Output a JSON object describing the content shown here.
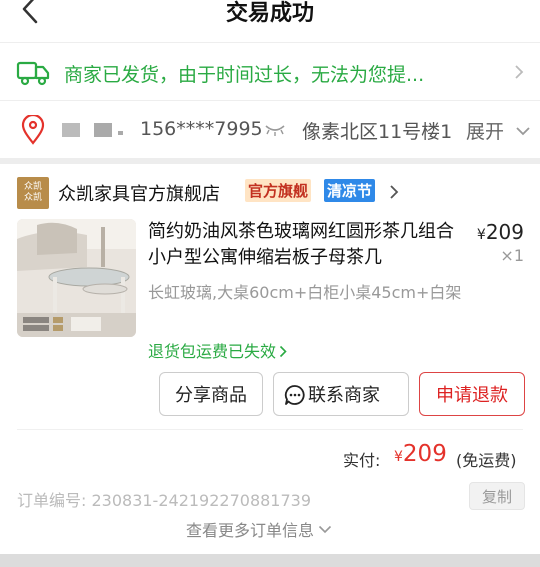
{
  "header": {
    "title": "交易成功"
  },
  "shipping": {
    "text": "商家已发货，由于时间过长，无法为您提..."
  },
  "address": {
    "phone": "156****7995",
    "text": "像素北区11号楼1",
    "expand_label": "展开"
  },
  "shop": {
    "logo_lines": [
      "众凯",
      "众凯"
    ],
    "name": "众凯家具官方旗舰店",
    "badge_official": "官方旗舰",
    "badge_promo": "清凉节"
  },
  "product": {
    "title": "简约奶油风茶色玻璃网红圆形茶几组合小户型公寓伸缩岩板子母茶几",
    "price_symbol": "¥",
    "price": "209",
    "qty": "×1",
    "spec": "长虹玻璃,大桌60cm+白柜小桌45cm+白架",
    "refund_note": "退货包运费已失效"
  },
  "actions": {
    "share_label": "分享商品",
    "contact_label": "联系商家",
    "refund_label": "申请退款"
  },
  "payment": {
    "label": "实付:",
    "symbol": "¥",
    "amount": "209",
    "shipping_note": "(免运费)"
  },
  "order": {
    "number_text": "订单编号:  230831-242192270881739",
    "copy_label": "复制",
    "more_label": "查看更多订单信息"
  },
  "colors": {
    "success_green": "#2aaa43",
    "price_red": "#e4322b",
    "promo_blue": "#2f89e8"
  }
}
